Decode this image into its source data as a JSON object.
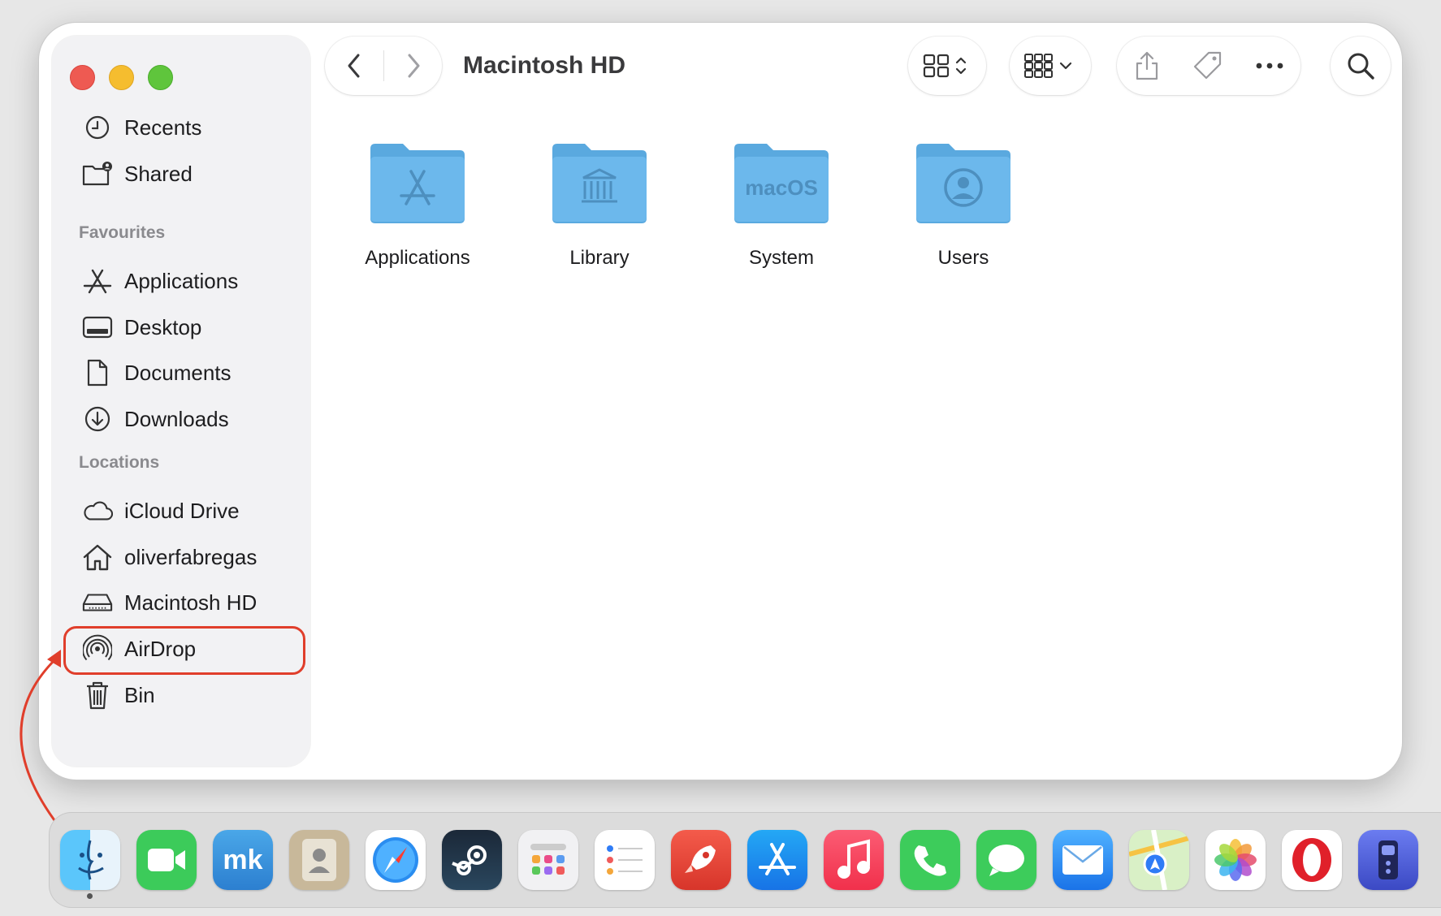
{
  "window": {
    "title": "Macintosh HD"
  },
  "sidebar": {
    "top_items": [
      {
        "label": "Recents",
        "icon": "clock-icon"
      },
      {
        "label": "Shared",
        "icon": "shared-folder-icon"
      }
    ],
    "favourites_header": "Favourites",
    "favourites": [
      {
        "label": "Applications",
        "icon": "applications-icon"
      },
      {
        "label": "Desktop",
        "icon": "desktop-icon"
      },
      {
        "label": "Documents",
        "icon": "document-icon"
      },
      {
        "label": "Downloads",
        "icon": "download-icon"
      }
    ],
    "locations_header": "Locations",
    "locations": [
      {
        "label": "iCloud Drive",
        "icon": "cloud-icon"
      },
      {
        "label": "oliverfabregas",
        "icon": "home-icon"
      },
      {
        "label": "Macintosh HD",
        "icon": "hard-drive-icon",
        "selected": true
      },
      {
        "label": "AirDrop",
        "icon": "airdrop-icon"
      },
      {
        "label": "Bin",
        "icon": "trash-icon"
      }
    ]
  },
  "content": {
    "folders": [
      {
        "label": "Applications",
        "glyph": "app-store-glyph"
      },
      {
        "label": "Library",
        "glyph": "building-glyph"
      },
      {
        "label": "System",
        "glyph": "macOS"
      },
      {
        "label": "Users",
        "glyph": "user-glyph"
      }
    ]
  },
  "dock": {
    "apps": [
      "Finder",
      "FaceTime",
      "Microsoft Edge-like mk",
      "Contacts",
      "Safari",
      "Steam",
      "Launchpad",
      "Reminders",
      "Rocket",
      "App Store",
      "Music",
      "Phone",
      "Messages",
      "Mail",
      "Maps",
      "Photos",
      "Opera",
      "Remote"
    ],
    "mk_label": "mk"
  },
  "colors": {
    "accent_red": "#e03e2b",
    "folder_blue": "#6cb6ea"
  }
}
